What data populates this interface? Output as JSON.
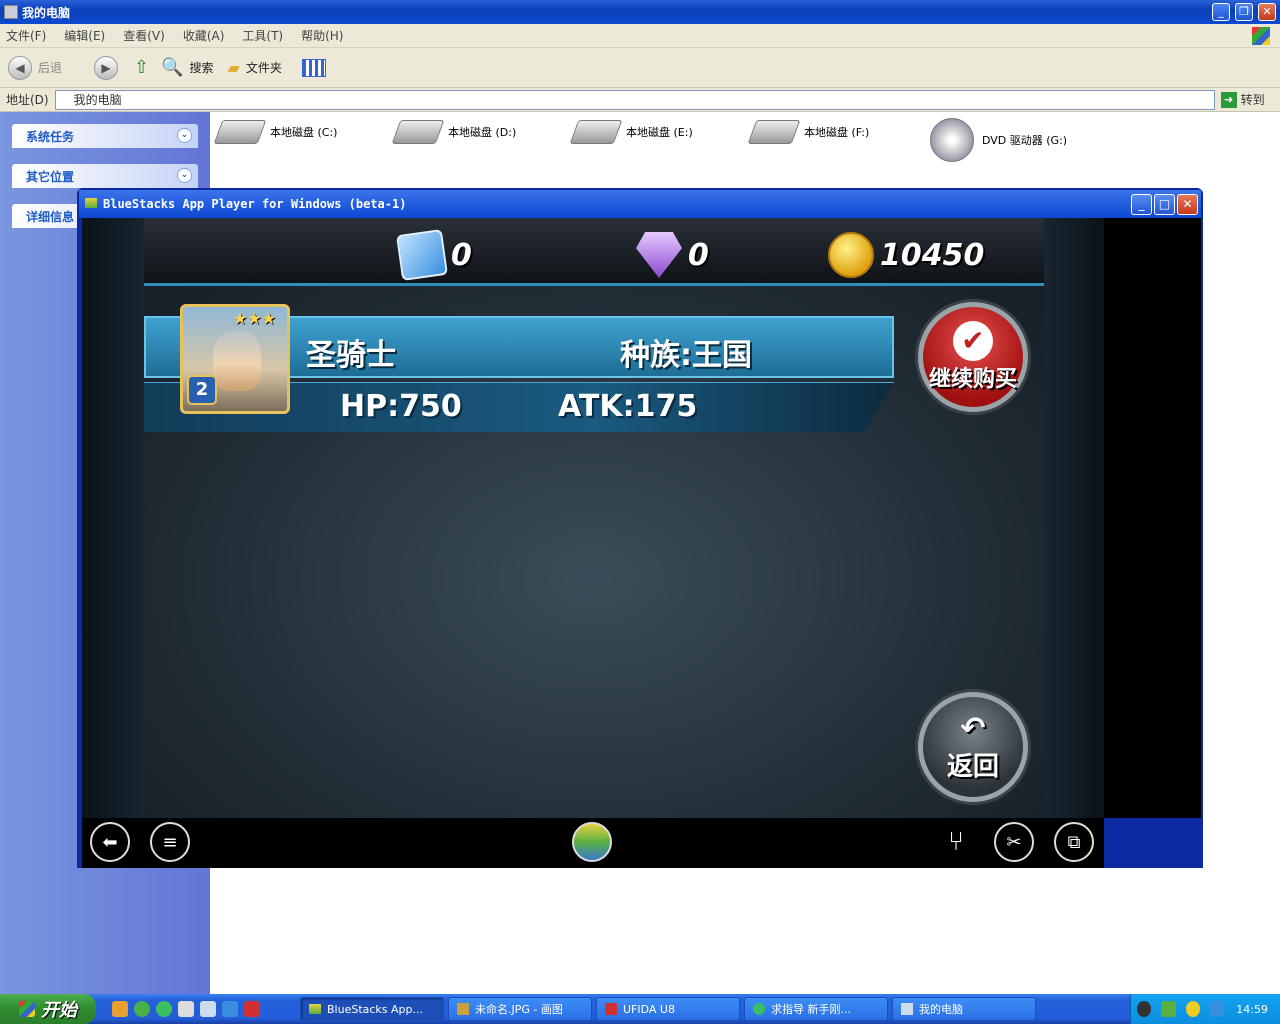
{
  "explorer": {
    "title": "我的电脑",
    "menu": [
      "文件(F)",
      "编辑(E)",
      "查看(V)",
      "收藏(A)",
      "工具(T)",
      "帮助(H)"
    ],
    "toolbar": {
      "back": "后退",
      "search": "搜索",
      "folders": "文件夹"
    },
    "address_label": "地址(D)",
    "address_value": "我的电脑",
    "go_label": "转到",
    "sidebar": [
      "系统任务",
      "其它位置",
      "详细信息"
    ],
    "drives": [
      "本地磁盘 (C:)",
      "本地磁盘 (D:)",
      "本地磁盘 (E:)",
      "本地磁盘 (F:)",
      "DVD 驱动器 (G:)"
    ]
  },
  "bluestacks": {
    "title": "BlueStacks App Player for Windows (beta-1)",
    "resources": {
      "cards": "0",
      "diamonds": "0",
      "gold": "10450"
    },
    "unit": {
      "name": "圣骑士",
      "race": "种族:王国",
      "hp": "HP:750",
      "atk": "ATK:175",
      "level": "2",
      "stars": "★★★"
    },
    "buttons": {
      "continue": "继续购买",
      "back": "返回"
    }
  },
  "taskbar": {
    "start": "开始",
    "tasks": [
      "BlueStacks App...",
      "未命名.JPG - 画图",
      "UFIDA U8",
      "求指导 新手刚...",
      "我的电脑"
    ],
    "clock": "14:59"
  },
  "colors": {
    "xp_blue": "#0a3fb8",
    "game_accent": "#2f8fb8",
    "continue_red": "#a01010"
  }
}
